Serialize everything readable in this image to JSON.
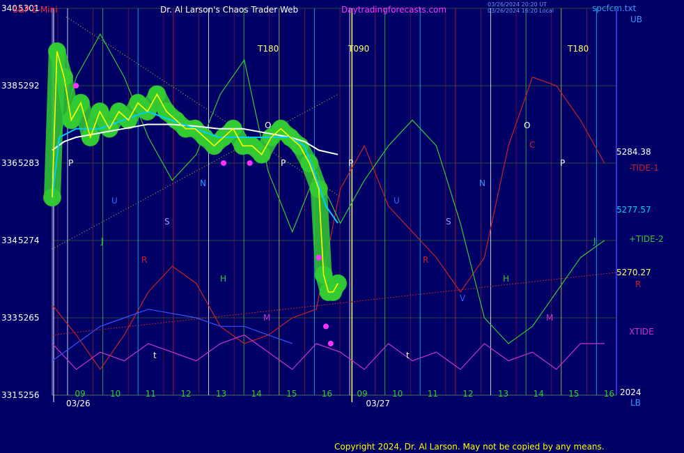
{
  "header": {
    "symbol": "S&P E-Mini",
    "title": "Dr. Al Larson's Chaos Trader Web",
    "site": "Daytradingforecasts.com",
    "timestamp1": "03/26/2024 20:20 UT",
    "timestamp2": "03/26/2024 16:20 Local",
    "file": "spcfcm.txt"
  },
  "footer": {
    "copyright": "Copyright 2024, Dr. Al Larson. May not be copied by any means."
  },
  "colors": {
    "background": "#000066",
    "price": "#ffff00",
    "ema_fast": "#00ccff",
    "ema_slow": "#ffffff",
    "green_band": "#33cc33",
    "tide1": "#cc2222",
    "tide2": "#33cc33",
    "xtide": "#cc33cc",
    "r_line": "#cc2222",
    "magenta_dots": "#ff33ff"
  },
  "chart_data": {
    "type": "line",
    "title": "S&P E-Mini",
    "y_left_labels": [
      {
        "a": "340",
        "b": "5301"
      },
      {
        "a": "338",
        "b": "5292"
      },
      {
        "a": "336",
        "b": "5283"
      },
      {
        "a": "334",
        "b": "5274"
      },
      {
        "a": "333",
        "b": "5265"
      },
      {
        "a": "331",
        "b": "5256"
      }
    ],
    "ylim": [
      5256,
      5301
    ],
    "upper_band_label": "UB",
    "lower_band_label": "LB",
    "x_hours": [
      "09",
      "10",
      "11",
      "12",
      "13",
      "14",
      "15",
      "16",
      "09",
      "10",
      "11",
      "12",
      "13",
      "14",
      "15",
      "16"
    ],
    "dates": [
      "03/26",
      "03/27"
    ],
    "year": "2024",
    "markers": [
      "T180",
      "T090",
      "T180"
    ],
    "cycle_letters": [
      "P",
      "U",
      "J",
      "S",
      "N",
      "R",
      "H",
      "M",
      "t",
      "P",
      "O",
      "P",
      "U",
      "R",
      "S",
      "V",
      "N",
      "H",
      "M",
      "t",
      "O",
      "C",
      "P",
      "J"
    ],
    "right_labels": [
      {
        "text": "5284.38",
        "series": "price_last"
      },
      {
        "text": "-TIDE-1",
        "series": "tide1"
      },
      {
        "text": "5277.57",
        "series": "ema_fast_last"
      },
      {
        "text": "+TIDE-2",
        "series": "tide2"
      },
      {
        "text": "5270.27",
        "series": "r_level"
      },
      {
        "text": "R",
        "series": "r"
      },
      {
        "text": "XTIDE",
        "series": "xtide"
      }
    ],
    "price_series": [
      [
        0,
        5279
      ],
      [
        0.2,
        5296
      ],
      [
        0.5,
        5293
      ],
      [
        0.8,
        5288
      ],
      [
        1.2,
        5290
      ],
      [
        1.6,
        5286
      ],
      [
        2.0,
        5289
      ],
      [
        2.4,
        5287
      ],
      [
        2.8,
        5289
      ],
      [
        3.2,
        5288
      ],
      [
        3.6,
        5290
      ],
      [
        4.0,
        5289
      ],
      [
        4.4,
        5291
      ],
      [
        4.8,
        5289
      ],
      [
        5.2,
        5288
      ],
      [
        5.6,
        5287
      ],
      [
        6.0,
        5287
      ],
      [
        6.4,
        5286
      ],
      [
        6.8,
        5285
      ],
      [
        7.2,
        5286
      ],
      [
        7.6,
        5287
      ],
      [
        8.0,
        5285
      ],
      [
        8.4,
        5285
      ],
      [
        8.8,
        5284
      ],
      [
        9.2,
        5286
      ],
      [
        9.6,
        5287
      ],
      [
        10.0,
        5286
      ],
      [
        10.4,
        5285
      ],
      [
        10.8,
        5283
      ],
      [
        11.2,
        5280
      ],
      [
        11.4,
        5270
      ],
      [
        11.6,
        5268
      ],
      [
        11.8,
        5268
      ],
      [
        12.0,
        5269
      ]
    ],
    "ema_fast": [
      [
        0,
        5279
      ],
      [
        0.3,
        5286
      ],
      [
        1.0,
        5287
      ],
      [
        2.0,
        5287
      ],
      [
        3.0,
        5288
      ],
      [
        4.0,
        5289
      ],
      [
        5.0,
        5288
      ],
      [
        6.0,
        5287
      ],
      [
        7.0,
        5286
      ],
      [
        8.0,
        5286
      ],
      [
        9.0,
        5286
      ],
      [
        10.0,
        5286
      ],
      [
        10.6,
        5285
      ],
      [
        11.0,
        5282
      ],
      [
        11.5,
        5278
      ],
      [
        12.0,
        5276
      ]
    ],
    "ema_slow": [
      [
        0,
        5284.5
      ],
      [
        0.5,
        5285.5
      ],
      [
        1.0,
        5286
      ],
      [
        2.0,
        5286.5
      ],
      [
        3.0,
        5287
      ],
      [
        4.0,
        5287.5
      ],
      [
        5.0,
        5287.5
      ],
      [
        6.0,
        5287.3
      ],
      [
        7.0,
        5287
      ],
      [
        8.0,
        5287
      ],
      [
        9.0,
        5286.5
      ],
      [
        10.0,
        5286
      ],
      [
        10.6,
        5285.5
      ],
      [
        11.2,
        5284.5
      ],
      [
        12.0,
        5284
      ]
    ],
    "tide1": [
      [
        0,
        5266.5
      ],
      [
        1,
        5263
      ],
      [
        2,
        5259
      ],
      [
        3,
        5263
      ],
      [
        4,
        5268
      ],
      [
        5,
        5271
      ],
      [
        6,
        5269
      ],
      [
        7,
        5264
      ],
      [
        8,
        5262
      ],
      [
        9,
        5263
      ],
      [
        10,
        5265
      ],
      [
        11,
        5266
      ],
      [
        12,
        5280
      ],
      [
        13,
        5285
      ],
      [
        14,
        5278
      ],
      [
        15,
        5275
      ],
      [
        16,
        5272
      ],
      [
        17,
        5268
      ],
      [
        18,
        5272
      ],
      [
        19,
        5285
      ],
      [
        20,
        5293
      ],
      [
        21,
        5292
      ],
      [
        22,
        5288
      ],
      [
        23,
        5283
      ]
    ],
    "tide2": [
      [
        0,
        5283
      ],
      [
        1,
        5293
      ],
      [
        2,
        5298
      ],
      [
        3,
        5293
      ],
      [
        4,
        5286
      ],
      [
        5,
        5281
      ],
      [
        6,
        5284
      ],
      [
        7,
        5291
      ],
      [
        8,
        5295
      ],
      [
        9,
        5282
      ],
      [
        10,
        5275
      ],
      [
        11,
        5282
      ],
      [
        12,
        5276
      ],
      [
        13,
        5281
      ],
      [
        14,
        5285
      ],
      [
        15,
        5288
      ],
      [
        16,
        5285
      ],
      [
        17,
        5276
      ],
      [
        18,
        5265
      ],
      [
        19,
        5262
      ],
      [
        20,
        5264
      ],
      [
        21,
        5268
      ],
      [
        22,
        5272
      ],
      [
        23,
        5274
      ]
    ],
    "xtide": [
      [
        0,
        5262
      ],
      [
        1,
        5259
      ],
      [
        2,
        5261
      ],
      [
        3,
        5260
      ],
      [
        4,
        5262
      ],
      [
        5,
        5261
      ],
      [
        6,
        5260
      ],
      [
        7,
        5262
      ],
      [
        8,
        5263
      ],
      [
        9,
        5261
      ],
      [
        10,
        5259
      ],
      [
        11,
        5262
      ],
      [
        12,
        5261
      ],
      [
        13,
        5259
      ],
      [
        14,
        5262
      ],
      [
        15,
        5260
      ],
      [
        16,
        5261
      ],
      [
        17,
        5259
      ],
      [
        18,
        5262
      ],
      [
        19,
        5260
      ],
      [
        20,
        5261
      ],
      [
        21,
        5259
      ],
      [
        22,
        5262
      ],
      [
        23,
        5262
      ]
    ],
    "blue_line": [
      [
        0,
        5260
      ],
      [
        1,
        5262
      ],
      [
        2,
        5264
      ],
      [
        3,
        5265
      ],
      [
        4,
        5266
      ],
      [
        5,
        5265.5
      ],
      [
        6,
        5265
      ],
      [
        7,
        5264
      ],
      [
        8,
        5264
      ],
      [
        9,
        5263
      ],
      [
        10,
        5262
      ]
    ],
    "r_level": 5270.27
  }
}
